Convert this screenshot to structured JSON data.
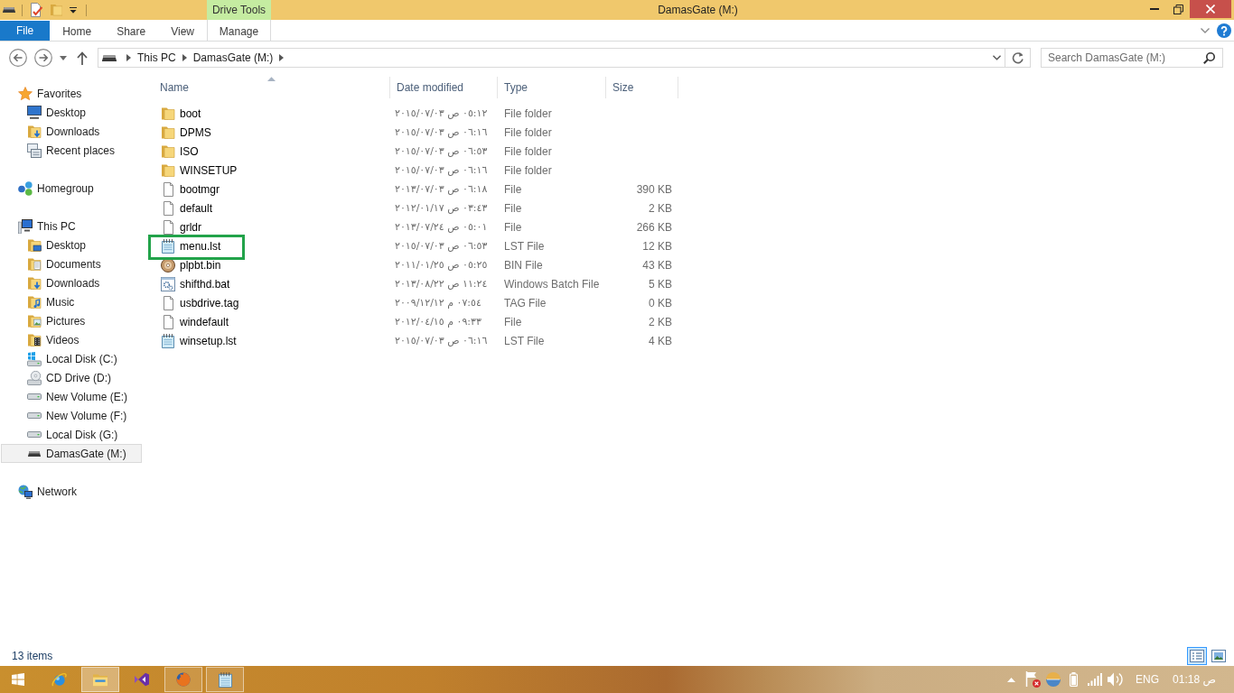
{
  "window": {
    "title": "DamasGate (M:)"
  },
  "ribbon": {
    "context_label": "Drive Tools",
    "tabs": [
      {
        "label": "File",
        "kind": "backstage",
        "selected": false
      },
      {
        "label": "Home",
        "kind": "standard",
        "selected": false
      },
      {
        "label": "Share",
        "kind": "standard",
        "selected": false
      },
      {
        "label": "View",
        "kind": "standard",
        "selected": false
      },
      {
        "label": "Manage",
        "kind": "contextual",
        "selected": false
      }
    ]
  },
  "address_bar": {
    "path": [
      "This PC",
      "DamasGate (M:)"
    ]
  },
  "search": {
    "placeholder": "Search DamasGate (M:)"
  },
  "navigation": [
    {
      "label": "Favorites",
      "kind": "favorites",
      "selected": false,
      "children": [
        {
          "label": "Desktop",
          "kind": "desktop",
          "selected": false
        },
        {
          "label": "Downloads",
          "kind": "downloads",
          "selected": false
        },
        {
          "label": "Recent places",
          "kind": "recent",
          "selected": false
        }
      ]
    },
    {
      "label": "Homegroup",
      "kind": "homegroup",
      "selected": false
    },
    {
      "label": "This PC",
      "kind": "computer",
      "selected": false,
      "children": [
        {
          "label": "Desktop",
          "kind": "desktopfolder",
          "selected": false
        },
        {
          "label": "Documents",
          "kind": "documents",
          "selected": false
        },
        {
          "label": "Downloads",
          "kind": "downloads",
          "selected": false
        },
        {
          "label": "Music",
          "kind": "music",
          "selected": false
        },
        {
          "label": "Pictures",
          "kind": "pictures",
          "selected": false
        },
        {
          "label": "Videos",
          "kind": "videos",
          "selected": false
        },
        {
          "label": "Local Disk (C:)",
          "kind": "system",
          "selected": false
        },
        {
          "label": "CD Drive (D:)",
          "kind": "optical",
          "selected": false
        },
        {
          "label": "New Volume (E:)",
          "kind": "drive",
          "selected": false
        },
        {
          "label": "New Volume (F:)",
          "kind": "drive",
          "selected": false
        },
        {
          "label": "Local Disk (G:)",
          "kind": "drive",
          "selected": false
        },
        {
          "label": "DamasGate (M:)",
          "kind": "removable",
          "selected": true
        }
      ]
    },
    {
      "label": "Network",
      "kind": "network",
      "selected": false
    }
  ],
  "table": {
    "columns": [
      {
        "label": "Name",
        "sorted": true
      },
      {
        "label": "Date modified",
        "sorted": false
      },
      {
        "label": "Type",
        "sorted": false
      },
      {
        "label": "Size",
        "sorted": false
      }
    ],
    "rows": [
      {
        "name": "boot",
        "kind": "folder",
        "modified": "٠٥:١٢ ص ٢٠١٥/٠٧/٠٣",
        "type": "File folder",
        "selected": false,
        "highlighted": false
      },
      {
        "name": "DPMS",
        "kind": "folder",
        "modified": "٠٦:١٦ ص ٢٠١٥/٠٧/٠٣",
        "type": "File folder",
        "selected": false,
        "highlighted": false
      },
      {
        "name": "ISO",
        "kind": "folder",
        "modified": "٠٦:٥٣ ص ٢٠١٥/٠٧/٠٣",
        "type": "File folder",
        "selected": false,
        "highlighted": false
      },
      {
        "name": "WINSETUP",
        "kind": "folder",
        "modified": "٠٦:١٦ ص ٢٠١٥/٠٧/٠٣",
        "type": "File folder",
        "selected": false,
        "highlighted": false
      },
      {
        "name": "bootmgr",
        "kind": "file",
        "modified": "٠٦:١٨ ص ٢٠١٣/٠٧/٠٣",
        "type": "File",
        "size": "390 KB",
        "selected": false,
        "highlighted": false
      },
      {
        "name": "default",
        "kind": "file",
        "modified": "٠٣:٤٣ ص ٢٠١٢/٠١/١٧",
        "type": "File",
        "size": "2 KB",
        "selected": false,
        "highlighted": false
      },
      {
        "name": "grldr",
        "kind": "file",
        "modified": "٠٥:٠١ ص ٢٠١٣/٠٧/٢٤",
        "type": "File",
        "size": "266 KB",
        "selected": false,
        "highlighted": false
      },
      {
        "name": "menu.lst",
        "kind": "text",
        "modified": "٠٦:٥٣ ص ٢٠١٥/٠٧/٠٣",
        "type": "LST File",
        "size": "12 KB",
        "selected": false,
        "highlighted": true
      },
      {
        "name": "plpbt.bin",
        "kind": "disc",
        "modified": "٠٥:٢٥ ص ٢٠١١/٠١/٢٥",
        "type": "BIN File",
        "size": "43 KB",
        "selected": false,
        "highlighted": false
      },
      {
        "name": "shifthd.bat",
        "kind": "batch",
        "modified": "١١:٢٤ ص ٢٠١٣/٠٨/٢٢",
        "type": "Windows Batch File",
        "size": "5 KB",
        "selected": false,
        "highlighted": false
      },
      {
        "name": "usbdrive.tag",
        "kind": "file",
        "modified": "٠٧:٥٤ م ٢٠٠٩/١٢/١٢",
        "type": "TAG File",
        "size": "0 KB",
        "selected": false,
        "highlighted": false
      },
      {
        "name": "windefault",
        "kind": "file",
        "modified": "٠٩:٣٣ م ٢٠١٢/٠٤/١٥",
        "type": "File",
        "size": "2 KB",
        "selected": false,
        "highlighted": false
      },
      {
        "name": "winsetup.lst",
        "kind": "text",
        "modified": "٠٦:١٦ ص ٢٠١٥/٠٧/٠٣",
        "type": "LST File",
        "size": "4 KB",
        "selected": false,
        "highlighted": false
      }
    ]
  },
  "status_bar": {
    "item_count": "13 items",
    "views": [
      {
        "kind": "details",
        "selected": true
      },
      {
        "kind": "tiles",
        "selected": false
      }
    ]
  },
  "taskbar": {
    "apps": [
      {
        "kind": "web",
        "running": false,
        "active": false
      },
      {
        "kind": "files",
        "running": true,
        "active": true
      },
      {
        "kind": "studio",
        "running": false,
        "active": false
      },
      {
        "kind": "browser",
        "running": true,
        "active": false
      },
      {
        "kind": "notes",
        "running": true,
        "active": false
      }
    ],
    "language": "ENG",
    "clock": "01:18 ص"
  }
}
